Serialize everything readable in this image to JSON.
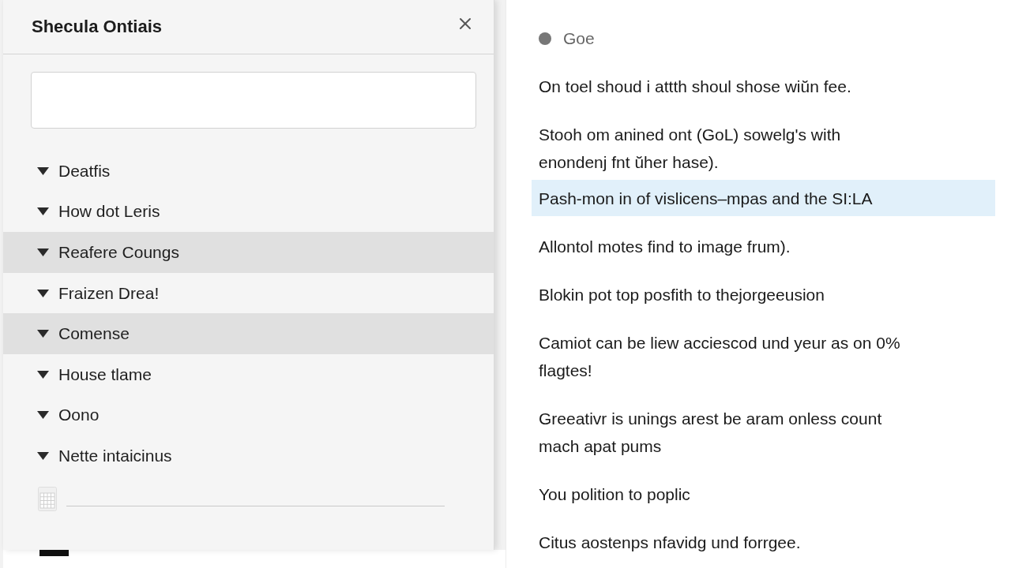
{
  "panel": {
    "title": "Shecula Ontiais",
    "items": [
      {
        "label": "Deatfis",
        "expanded": true,
        "selected": false
      },
      {
        "label": "How dot Leris",
        "expanded": true,
        "selected": false
      },
      {
        "label": "Reafere Coungs",
        "expanded": true,
        "selected": true
      },
      {
        "label": "Fraizen Drea!",
        "expanded": true,
        "selected": false
      },
      {
        "label": "Comense",
        "expanded": true,
        "selected": true
      },
      {
        "label": "House tlame",
        "expanded": true,
        "selected": false
      },
      {
        "label": "Oono",
        "expanded": true,
        "selected": false
      },
      {
        "label": "Nette intaicinus",
        "expanded": true,
        "selected": false
      }
    ]
  },
  "content": {
    "status": {
      "label": "Goe"
    },
    "paragraphs": [
      {
        "lines": [
          "On toel shoud i attth shoul shose wiŭn fee."
        ],
        "highlighted": false
      },
      {
        "lines": [
          "Stooh om anined ont (GoL) sowelg's with",
          "enondenj fnt ŭher hase)."
        ],
        "highlighted": false
      },
      {
        "lines": [
          "Pash-mon in of vislicens–mpas and the SI:LA"
        ],
        "highlighted": true
      },
      {
        "lines": [
          "Allontol motes find to image frum)."
        ],
        "highlighted": false
      },
      {
        "lines": [
          "Blokin pot top posfith to thejorgeeusion"
        ],
        "highlighted": false
      },
      {
        "lines": [
          "Camiot can be liew acciescod und yeur as on 0%",
          "flagtes!"
        ],
        "highlighted": false
      },
      {
        "lines": [
          "Greeativr is unings arest be aram onless count",
          "mach apat pums"
        ],
        "highlighted": false
      },
      {
        "lines": [
          "You polition to poplic"
        ],
        "highlighted": false
      },
      {
        "lines": [
          "Citus aostenps nfavidg und forrgee."
        ],
        "highlighted": false
      }
    ]
  }
}
